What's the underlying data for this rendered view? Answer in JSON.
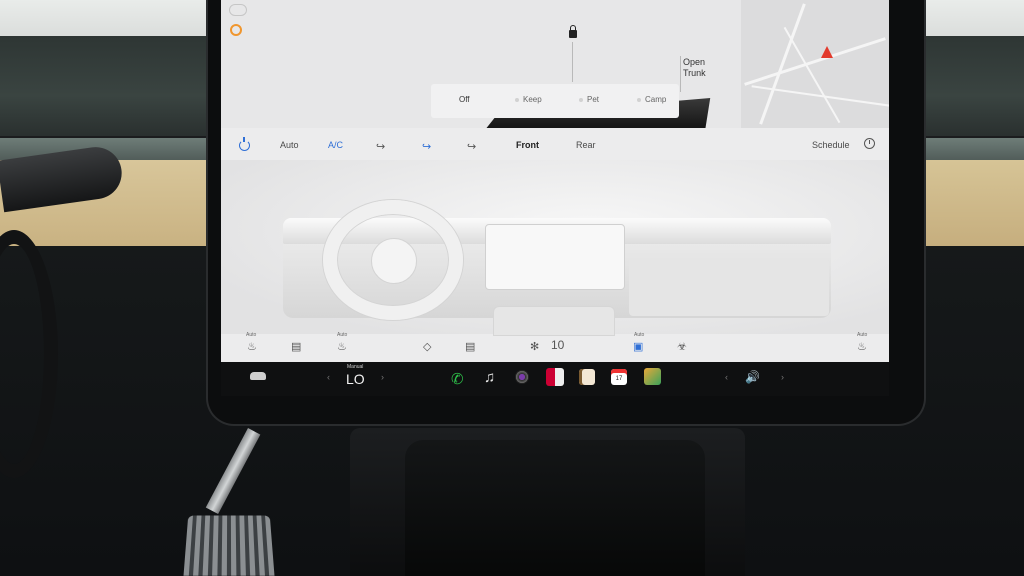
{
  "map": {
    "open_trunk_line1": "Open",
    "open_trunk_line2": "Trunk",
    "climate_modes": [
      "Off",
      "Keep",
      "Pet",
      "Camp"
    ]
  },
  "climate": {
    "auto": "Auto",
    "ac": "A/C",
    "front": "Front",
    "rear": "Rear",
    "schedule": "Schedule"
  },
  "seats": {
    "auto_label": "Auto",
    "fan_speed": "10"
  },
  "taskbar": {
    "temp_mode": "Manual",
    "temperature": "LO",
    "calendar_day": "17"
  },
  "colors": {
    "accent_blue": "#2f6fd6",
    "phone_green": "#2ec04a",
    "warning_orange": "#f0962e",
    "nav_red": "#e23a2c"
  }
}
